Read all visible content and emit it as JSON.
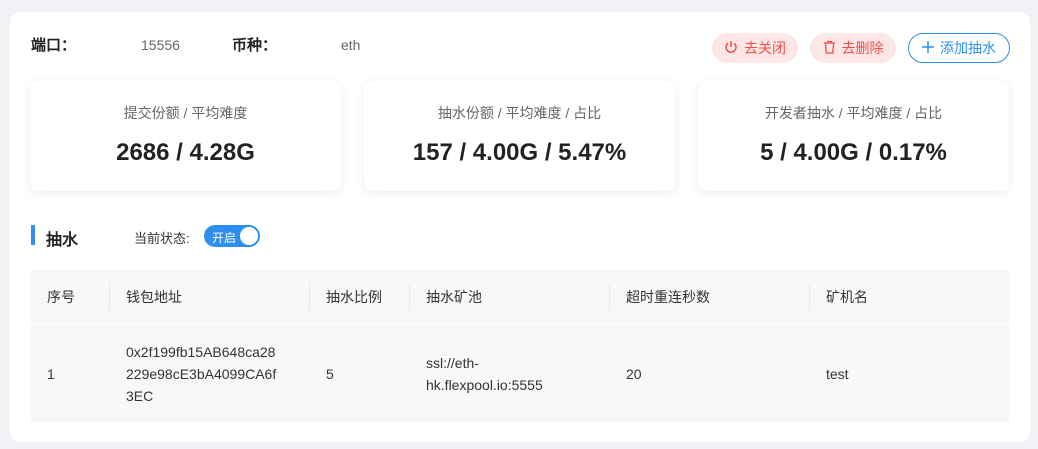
{
  "header": {
    "port_label": "端口：",
    "port_value": "15556",
    "coin_label": "币种：",
    "coin_value": "eth"
  },
  "buttons": {
    "close": "去关闭",
    "delete": "去删除",
    "add": "添加抽水"
  },
  "cards": [
    {
      "title": "提交份额 / 平均难度",
      "value": "2686 / 4.28G"
    },
    {
      "title": "抽水份额 / 平均难度 / 占比",
      "value": "157 / 4.00G / 5.47%"
    },
    {
      "title": "开发者抽水 / 平均难度 / 占比",
      "value": "5 / 4.00G / 0.17%"
    }
  ],
  "section": {
    "title": "抽水",
    "status_label": "当前状态:",
    "toggle_text": "开启",
    "toggle_on": true
  },
  "table": {
    "columns": [
      "序号",
      "钱包地址",
      "抽水比例",
      "抽水矿池",
      "超时重连秒数",
      "矿机名"
    ],
    "rows": [
      {
        "index": "1",
        "wallet_l1": "0x2f199fb15AB648ca28",
        "wallet_l2": "229e98cE3bA4099CA6f",
        "wallet_l3": "3EC",
        "ratio": "5",
        "pool_l1": "ssl://eth-",
        "pool_l2": "hk.flexpool.io:5555",
        "timeout": "20",
        "worker": "test"
      }
    ]
  },
  "colors": {
    "accent": "#2e8ff0",
    "danger": "#f0504a"
  }
}
